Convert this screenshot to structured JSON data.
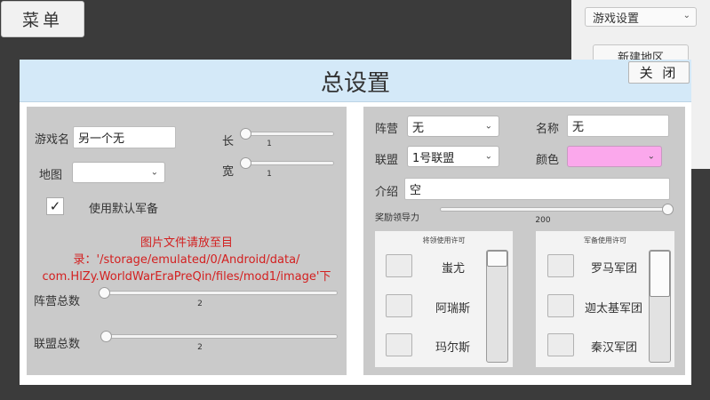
{
  "menu": {
    "label": "菜单"
  },
  "side": {
    "game_settings": "游戏设置",
    "new_region": "新建地区"
  },
  "dialog": {
    "title": "总设置",
    "close_label": "关 闭",
    "header_color": "#d4e9f8"
  },
  "left": {
    "game_name_label": "游戏名",
    "game_name_value": "另一个无",
    "map_label": "地图",
    "map_value": "",
    "length_label": "长",
    "length_value": "1",
    "width_label": "宽",
    "width_value": "1",
    "default_equipment_label": "使用默认军备",
    "default_equipment_checked": "✓",
    "path_note_line1": "图片文件请放至目录：'/storage/emulated/0/Android/data/",
    "path_note_line2": "com.HlZy.WorldWarEraPreQin/files/mod1/image'下",
    "camp_total_label": "阵营总数",
    "camp_total_value": "2",
    "alliance_total_label": "联盟总数",
    "alliance_total_value": "2"
  },
  "right": {
    "camp_label": "阵营",
    "camp_value": "无",
    "name_label": "名称",
    "name_value": "无",
    "alliance_label": "联盟",
    "alliance_value": "1号联盟",
    "color_label": "颜色",
    "color_value": "#fba8ec",
    "intro_label": "介绍",
    "intro_value": "空",
    "reward_label": "奖励领导力",
    "reward_value": "200",
    "general_box": {
      "title": "将领使用许可",
      "items": [
        "蚩尤",
        "阿瑞斯",
        "玛尔斯"
      ]
    },
    "equipment_box": {
      "title": "军备使用许可",
      "items": [
        "罗马军团",
        "迦太基军团",
        "秦汉军团"
      ]
    }
  }
}
